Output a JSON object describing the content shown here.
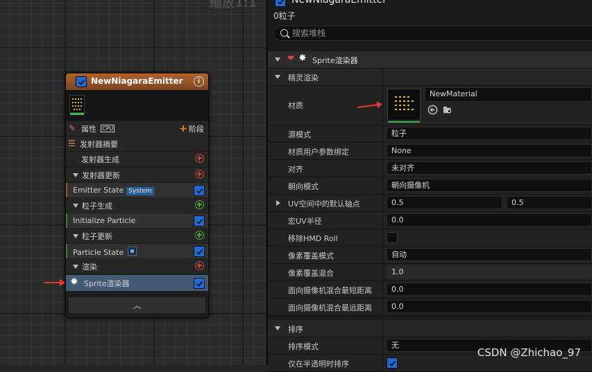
{
  "graph": {
    "zoom_label": "缩放1:1",
    "node": {
      "title": "NewNiagaraEmitter",
      "properties_label": "属性",
      "cpu_tag": "CPU",
      "stage_label": "阶段",
      "rows": [
        {
          "label": "发射器摘要",
          "kind": "summary"
        },
        {
          "label": "发射器生成",
          "kind": "sub"
        },
        {
          "label": "发射器更新",
          "kind": "section"
        },
        {
          "label": "Emitter State",
          "kind": "module",
          "tag": "System"
        },
        {
          "label": "粒子生成",
          "kind": "section"
        },
        {
          "label": "Initialize Particle",
          "kind": "module"
        },
        {
          "label": "粒子更新",
          "kind": "section"
        },
        {
          "label": "Particle State",
          "kind": "module"
        },
        {
          "label": "渲染",
          "kind": "section"
        },
        {
          "label": "Sprite渲染器",
          "kind": "renderer"
        }
      ]
    }
  },
  "panel": {
    "emitter_name": "NewNiagaraEmitter",
    "particle_count": "0粒子",
    "search_placeholder": "搜索堆栈",
    "renderer_header": "Sprite渲染器",
    "group_sprite": "精灵渲染",
    "material_label": "材质",
    "material_value": "NewMaterial",
    "rows": [
      {
        "label": "源模式",
        "value": "粒子"
      },
      {
        "label": "材质用户参数绑定",
        "value": "None"
      },
      {
        "label": "对齐",
        "value": "未对齐"
      },
      {
        "label": "朝向模式",
        "value": "朝向摄像机"
      },
      {
        "label": "UV空间中的默认轴点",
        "value": "0.5",
        "value2": "0.5"
      },
      {
        "label": "宏UV半径",
        "value": "0.0"
      },
      {
        "label": "移除HMD Roll",
        "value": ""
      },
      {
        "label": "像素覆盖模式",
        "value": "自动"
      },
      {
        "label": "像素覆盖混合",
        "value": "1.0"
      },
      {
        "label": "面向摄像机混合最短距离",
        "value": "0.0"
      },
      {
        "label": "面向摄像机混合最远距离",
        "value": "0.0"
      }
    ],
    "group_sort": "排序",
    "sort_rows": [
      {
        "label": "排序模式",
        "value": "无"
      },
      {
        "label": "仅在半透明时排序",
        "value": ""
      }
    ]
  },
  "watermark": "CSDN @Zhichao_97",
  "colors": {
    "accent": "#1f6bd6",
    "node_header": "#b0632c",
    "arrow": "#e53a2f",
    "selected_row": "#425a73"
  },
  "icons": [
    "checkbox-icon",
    "info-icon",
    "pencil-icon",
    "list-icon",
    "plus-circle-icon",
    "sprite-icon",
    "chevron-up-icon",
    "search-icon",
    "arrow-left-icon",
    "browse-icon"
  ]
}
